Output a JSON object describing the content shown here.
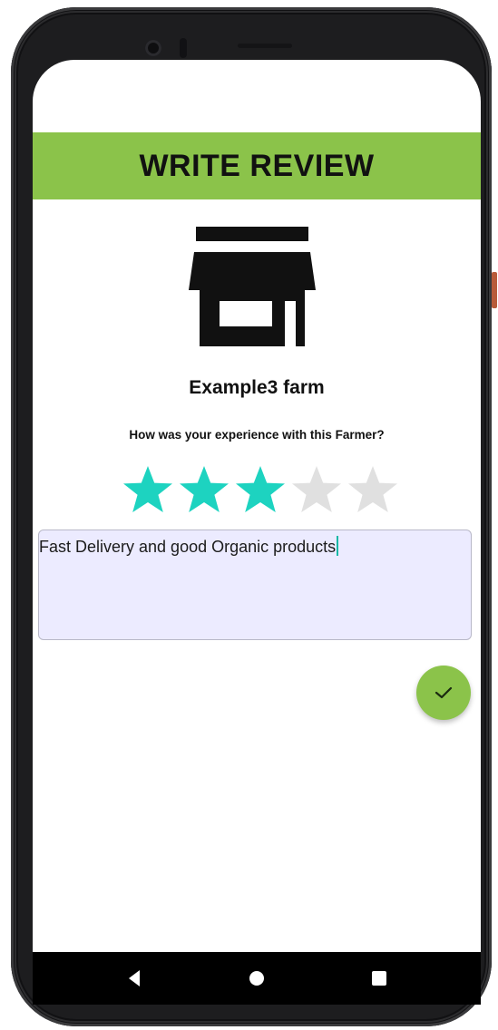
{
  "header": {
    "title": "WRITE REVIEW"
  },
  "farm": {
    "name": "Example3 farm"
  },
  "rating": {
    "question": "How was your experience with this Farmer?",
    "value": 3,
    "max": 5
  },
  "review": {
    "text": "Fast Delivery and good Organic products"
  },
  "fab": {
    "icon": "check-icon"
  },
  "navbar": {
    "back_icon": "back-icon",
    "home_icon": "home-icon",
    "recents_icon": "recents-icon"
  },
  "colors": {
    "accent": "#8bc34a",
    "star_filled": "#1dd3c0",
    "star_empty": "#e0e0e0",
    "input_bg": "#ecebff"
  }
}
